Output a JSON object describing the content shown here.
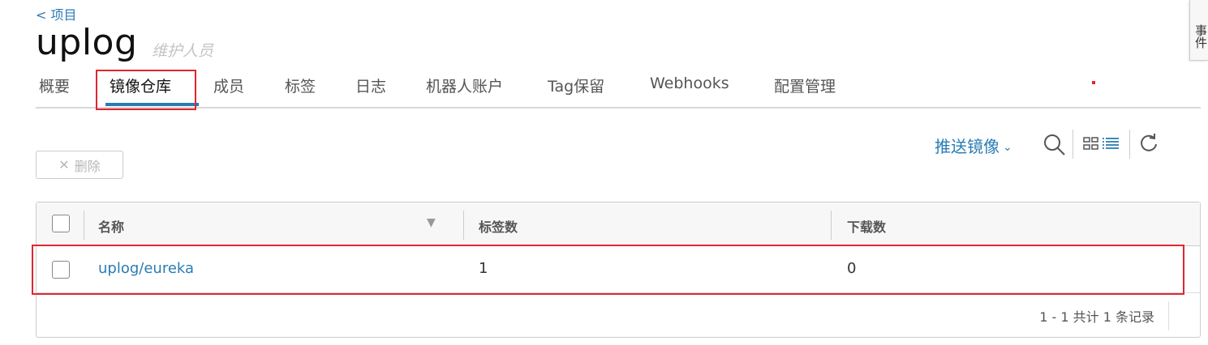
{
  "header": {
    "back_link": "< 项目",
    "title": "uplog",
    "role": "维护人员",
    "side_tab": "事件"
  },
  "tabs": [
    {
      "label": "概要"
    },
    {
      "label": "镜像仓库",
      "active": true
    },
    {
      "label": "成员"
    },
    {
      "label": "标签"
    },
    {
      "label": "日志"
    },
    {
      "label": "机器人账户"
    },
    {
      "label": "Tag保留"
    },
    {
      "label": "Webhooks"
    },
    {
      "label": "配置管理"
    }
  ],
  "toolbar": {
    "push_label": "推送镜像",
    "delete_label": "删除",
    "icons": [
      "search-icon",
      "card-view-icon",
      "list-view-icon",
      "refresh-icon"
    ]
  },
  "table": {
    "columns": [
      "名称",
      "标签数",
      "下载数"
    ],
    "rows": [
      {
        "name": "uplog/eureka",
        "tags": "1",
        "pulls": "0"
      }
    ],
    "footer": "1 - 1 共计 1 条记录"
  },
  "colors": {
    "accent": "#2a7cb3",
    "highlight": "#e0262f"
  }
}
